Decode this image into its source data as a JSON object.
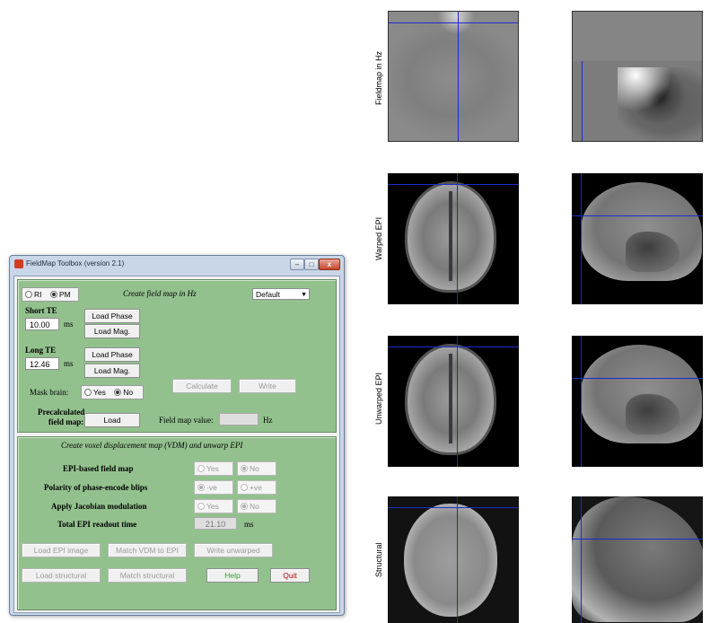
{
  "window": {
    "title": "FieldMap Toolbox (version 2.1)",
    "buttons": {
      "minimize": "–",
      "maximize": "□",
      "close": "x"
    }
  },
  "top_panel": {
    "mode_ri": "RI",
    "mode_pm": "PM",
    "selected_mode": "PM",
    "heading": "Create field map in Hz",
    "preset_select": "Default",
    "short_te": {
      "label": "Short TE",
      "value": "10.00",
      "unit": "ms"
    },
    "long_te": {
      "label": "Long TE",
      "value": "12.46",
      "unit": "ms"
    },
    "load_phase_1": "Load Phase",
    "load_mag_1": "Load Mag.",
    "load_phase_2": "Load Phase",
    "load_mag_2": "Load Mag.",
    "mask_brain": {
      "label": "Mask brain:",
      "yes": "Yes",
      "no": "No",
      "selected": "No"
    },
    "calculate": "Calculate",
    "write": "Write",
    "precalc_label_1": "Precalculated",
    "precalc_label_2": "field map:",
    "load": "Load",
    "field_map_value": {
      "label": "Field map value:",
      "value": "",
      "unit": "Hz"
    }
  },
  "bottom_panel": {
    "heading": "Create voxel displacement map (VDM) and unwarp EPI",
    "epi_based": {
      "label": "EPI-based field map",
      "yes": "Yes",
      "no": "No",
      "selected": "No"
    },
    "polarity": {
      "label": "Polarity of phase-encode blips",
      "neg": "-ve",
      "pos": "+ve",
      "selected": "-ve"
    },
    "jacobian": {
      "label": "Apply Jacobian modulation",
      "yes": "Yes",
      "no": "No",
      "selected": "No"
    },
    "readout": {
      "label": "Total EPI readout time",
      "value": "21.10",
      "unit": "ms"
    },
    "load_epi": "Load EPI image",
    "match_vdm": "Match VDM to EPI",
    "write_unwarped": "Write unwarped",
    "load_structural": "Load structural",
    "match_structural": "Match structural",
    "help": "Help",
    "quit": "Quit"
  },
  "figure": {
    "row_labels": [
      "Fieldmap in Hz",
      "Warped EPI",
      "Unwarped EPI",
      "Structural"
    ]
  },
  "colors": {
    "panel_green": "#93c18e",
    "crosshair": "#1a2ccf",
    "help_text": "#2f9e2f",
    "quit_text": "#c00000"
  }
}
